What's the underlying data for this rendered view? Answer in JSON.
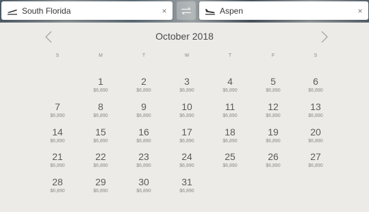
{
  "search": {
    "from": {
      "value": "South Florida",
      "clear": "×",
      "icon": "plane-departure-icon"
    },
    "to": {
      "value": "Aspen",
      "clear": "×",
      "icon": "plane-arrival-icon"
    },
    "swap_icon": "swap-arrows-icon"
  },
  "calendar": {
    "month_label": "October 2018",
    "prev_icon": "chevron-left-icon",
    "next_icon": "chevron-right-icon",
    "weekdays": [
      "S",
      "M",
      "T",
      "W",
      "T",
      "F",
      "S"
    ],
    "weeks": [
      [
        null,
        {
          "day": "1",
          "price": "$6,890"
        },
        {
          "day": "2",
          "price": "$6,890"
        },
        {
          "day": "3",
          "price": "$6,890"
        },
        {
          "day": "4",
          "price": "$6,890"
        },
        {
          "day": "5",
          "price": "$6,890"
        },
        {
          "day": "6",
          "price": "$6,890"
        }
      ],
      [
        {
          "day": "7",
          "price": "$6,890"
        },
        {
          "day": "8",
          "price": "$6,890"
        },
        {
          "day": "9",
          "price": "$6,890"
        },
        {
          "day": "10",
          "price": "$6,890"
        },
        {
          "day": "11",
          "price": "$6,890"
        },
        {
          "day": "12",
          "price": "$6,890"
        },
        {
          "day": "13",
          "price": "$6,890"
        }
      ],
      [
        {
          "day": "14",
          "price": "$6,890"
        },
        {
          "day": "15",
          "price": "$6,890"
        },
        {
          "day": "16",
          "price": "$6,890"
        },
        {
          "day": "17",
          "price": "$6,890"
        },
        {
          "day": "18",
          "price": "$6,890"
        },
        {
          "day": "19",
          "price": "$6,890"
        },
        {
          "day": "20",
          "price": "$6,890"
        }
      ],
      [
        {
          "day": "21",
          "price": "$6,890"
        },
        {
          "day": "22",
          "price": "$6,890"
        },
        {
          "day": "23",
          "price": "$6,890"
        },
        {
          "day": "24",
          "price": "$6,890"
        },
        {
          "day": "25",
          "price": "$6,890"
        },
        {
          "day": "26",
          "price": "$6,890"
        },
        {
          "day": "27",
          "price": "$6,890"
        }
      ],
      [
        {
          "day": "28",
          "price": "$6,890"
        },
        {
          "day": "29",
          "price": "$6,890"
        },
        {
          "day": "30",
          "price": "$6,890"
        },
        {
          "day": "31",
          "price": "$6,890"
        },
        null,
        null,
        null
      ]
    ]
  }
}
